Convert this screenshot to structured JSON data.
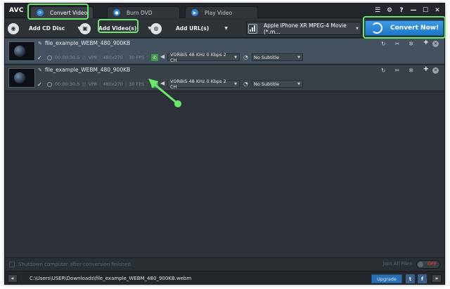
{
  "app": {
    "logo": "AVC"
  },
  "tabs": [
    {
      "label": "Convert Video",
      "icon": "refresh-icon",
      "active": true
    },
    {
      "label": "Burn DVD",
      "icon": "disc-icon",
      "active": false
    },
    {
      "label": "Play Video",
      "icon": "play-icon",
      "active": false
    }
  ],
  "window_controls": {
    "menu": "☰",
    "settings": "⚙",
    "help": "?",
    "minimize": "—",
    "maximize": "☐",
    "close": "✕"
  },
  "toolbar": {
    "add_cd": "Add CD Disc",
    "add_video": "Add Video(s)",
    "add_url": "Add URL(s)",
    "profile": "Apple iPhone XR MPEG-4 Movie (*.m...",
    "convert_now": "Convert Now!"
  },
  "files": [
    {
      "name": "file_example_WEBM_480_900KB",
      "duration": "00:00:30.5",
      "codec": "VP8",
      "resolution": "480x270",
      "fps": "30 FPS",
      "audio": "VORBIS 48 KHz 0 Kbps 2 CH",
      "subtitle": "No Subtitle",
      "selected": true
    },
    {
      "name": "file_example_WEBM_480_900KB",
      "duration": "00:00:30.5",
      "codec": "VP8",
      "resolution": "480x270",
      "fps": "30 FPS",
      "audio": "VORBIS 48 KHz 0 Kbps 2 CH",
      "subtitle": "No Subtitle",
      "selected": false
    }
  ],
  "bottom": {
    "shutdown_label": "Shutdown computer after conversion finished",
    "join_label": "Join All Files",
    "join_toggle": "OFF"
  },
  "statusbar": {
    "back": "«",
    "path": "C:\\Users\\USER\\Downloads\\file_example_WEBM_480_900KB.webm",
    "upgrade": "Upgrade",
    "twitter": "t",
    "facebook": "f",
    "forward": "»"
  },
  "colors": {
    "window_bg": "#2b3035",
    "accent_blue": "#2a86d6",
    "highlight_green": "#6be86a",
    "selected_row": "#445260"
  }
}
